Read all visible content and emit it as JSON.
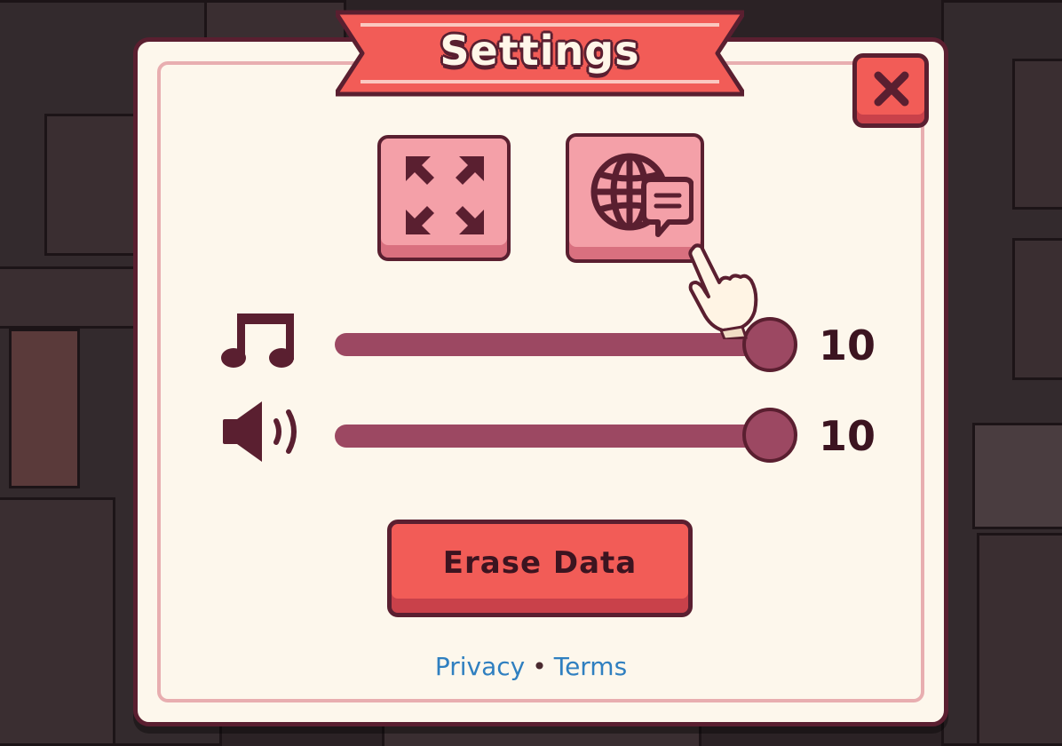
{
  "dialog": {
    "title": "Settings",
    "close_icon": "close-icon",
    "fullscreen_icon": "fullscreen-arrows-icon",
    "language_icon": "globe-chat-icon"
  },
  "music": {
    "icon": "music-note-icon",
    "value": "10",
    "level": 1.0
  },
  "sound": {
    "icon": "speaker-icon",
    "value": "10",
    "level": 1.0
  },
  "erase": {
    "label": "Erase Data"
  },
  "links": {
    "privacy": "Privacy",
    "separator": "•",
    "terms": "Terms"
  },
  "colors": {
    "primary": "#f25c57",
    "outline": "#5a1f30",
    "panel": "#fdf7ec",
    "button_pink": "#f4a0a8",
    "slider": "#9c4862",
    "link": "#2f7fc0"
  }
}
